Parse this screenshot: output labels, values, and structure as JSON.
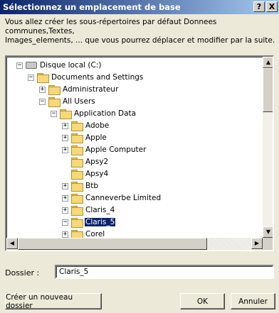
{
  "dialog": {
    "title": "Sélectionnez un emplacement de base",
    "help_label": "?",
    "close_label": "X",
    "description": "Vous allez créer les sous-répertoires par défaut Donnees communes,Textes,\nImages_elements, ... que vous pourrez déplacer et modifier par la suite."
  },
  "tree": {
    "items": [
      {
        "label": "Disque local (C:)",
        "expander": "⊟",
        "icon": "drive-icon"
      },
      {
        "label": "Documents and Settings",
        "expander": "⊟",
        "icon": "folder-icon"
      },
      {
        "label": "Administrateur",
        "expander": "⊞",
        "icon": "folder-icon"
      },
      {
        "label": "All Users",
        "expander": "⊟",
        "icon": "folder-icon"
      },
      {
        "label": "Application Data",
        "expander": "⊟",
        "icon": "folder-icon"
      },
      {
        "label": "Adobe",
        "expander": "⊞",
        "icon": "folder-icon"
      },
      {
        "label": "Apple",
        "expander": "⊞",
        "icon": "folder-icon"
      },
      {
        "label": "Apple Computer",
        "expander": "⊞",
        "icon": "folder-icon"
      },
      {
        "label": "Apsy2",
        "expander": "",
        "icon": "folder-icon"
      },
      {
        "label": "Apsy4",
        "expander": "",
        "icon": "folder-icon"
      },
      {
        "label": "Btb",
        "expander": "⊞",
        "icon": "folder-icon"
      },
      {
        "label": "Canneverbe Limited",
        "expander": "⊞",
        "icon": "folder-icon"
      },
      {
        "label": "Claris_4",
        "expander": "⊞",
        "icon": "folder-icon"
      },
      {
        "label": "Claris_5",
        "expander": "⊟",
        "icon": "folder-icon",
        "selected": true
      },
      {
        "label": "Corel",
        "expander": "⊞",
        "icon": "folder-icon"
      }
    ],
    "scroll_up": "▲",
    "scroll_down": "▼",
    "scroll_left": "◀",
    "scroll_right": "▶"
  },
  "folder_field": {
    "label": "Dossier :",
    "value": "Claris_5"
  },
  "buttons": {
    "new_folder": "Créer un nouveau dossier",
    "ok": "OK",
    "cancel": "Annuler"
  }
}
